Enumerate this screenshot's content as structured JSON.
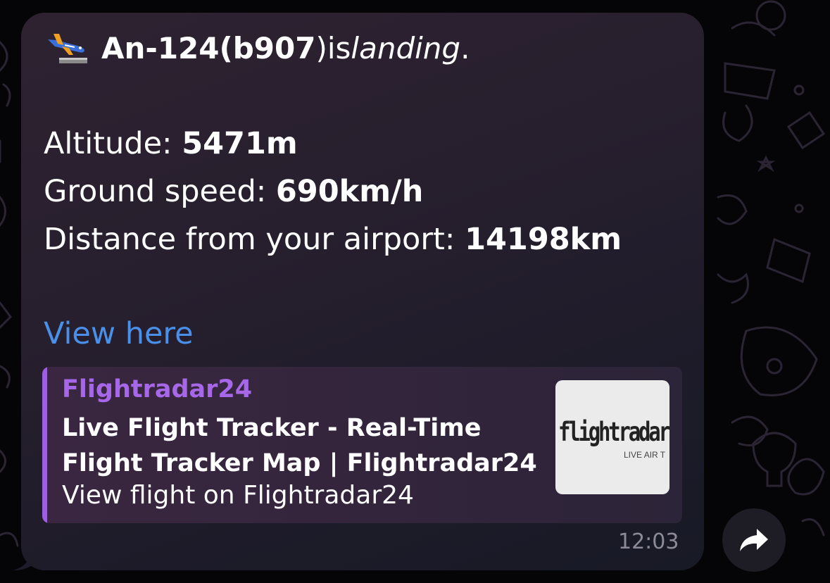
{
  "message": {
    "aircraft": "An-124",
    "code_open": " (",
    "code": "b907",
    "code_close": ")",
    "verb": " is ",
    "status": "landing",
    "period": ".",
    "stats": [
      {
        "label": "Altitude: ",
        "value": "5471m"
      },
      {
        "label": "Ground speed: ",
        "value": "690km/h"
      },
      {
        "label": "Distance from your airport: ",
        "value": "14198km"
      }
    ],
    "link_text": "View here",
    "time": "12:03"
  },
  "preview": {
    "site_name": "Flightradar24",
    "title": "Live Flight Tracker - Real-Time Flight Tracker Map | Flightradar24",
    "description": "View flight  on Flightradar24",
    "thumbnail": {
      "logo_text": "flightradar",
      "tagline": "LIVE AIR T"
    },
    "accent_color": "#9b5fe0"
  },
  "colors": {
    "link": "#4a8fe8",
    "bubble": "#2a2130",
    "timestamp": "#8c8a96"
  },
  "icons": {
    "plane": "airplane-landing-icon",
    "forward": "forward-arrow-icon"
  }
}
